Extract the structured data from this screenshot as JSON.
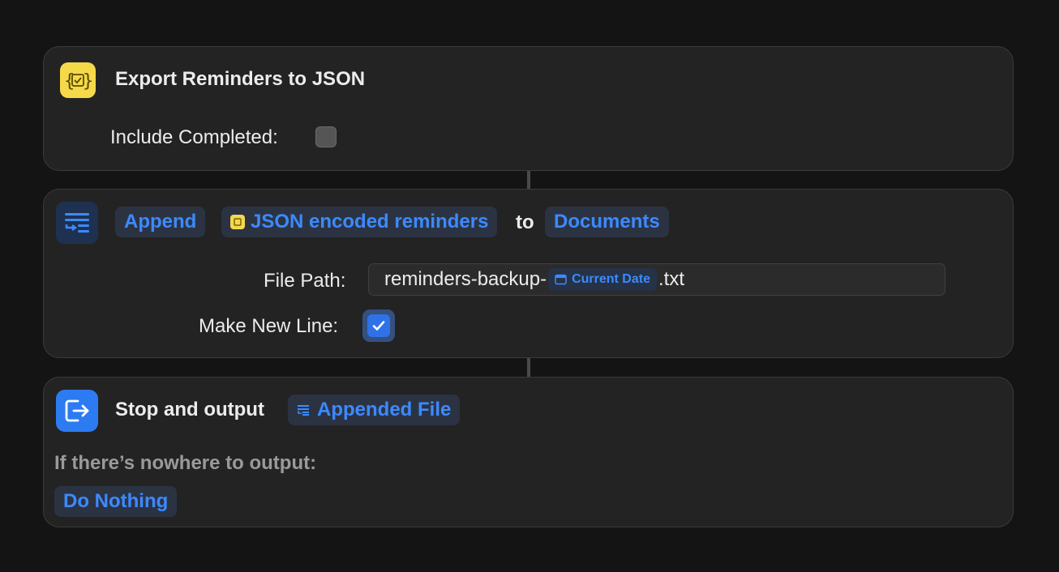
{
  "actions": {
    "export": {
      "title": "Export Reminders to JSON",
      "include_completed_label": "Include Completed:",
      "include_completed_checked": false,
      "icon": "braces-checkbox-icon"
    },
    "append": {
      "verb": "Append",
      "input_token": "JSON encoded reminders",
      "to_word": "to",
      "destination": "Documents",
      "file_path_label": "File Path:",
      "file_path_prefix": "reminders-backup-",
      "file_path_variable": "Current Date",
      "file_path_suffix": ".txt",
      "make_new_line_label": "Make New Line:",
      "make_new_line_checked": true,
      "icon": "append-lines-icon"
    },
    "stop": {
      "title": "Stop and output",
      "output_token": "Appended File",
      "fallback_label": "If there’s nowhere to output:",
      "fallback_value": "Do Nothing",
      "icon": "exit-door-icon"
    }
  },
  "colors": {
    "background": "#141414",
    "card": "#232323",
    "accent_blue": "#3c8aff",
    "accent_yellow": "#f5d94a"
  }
}
